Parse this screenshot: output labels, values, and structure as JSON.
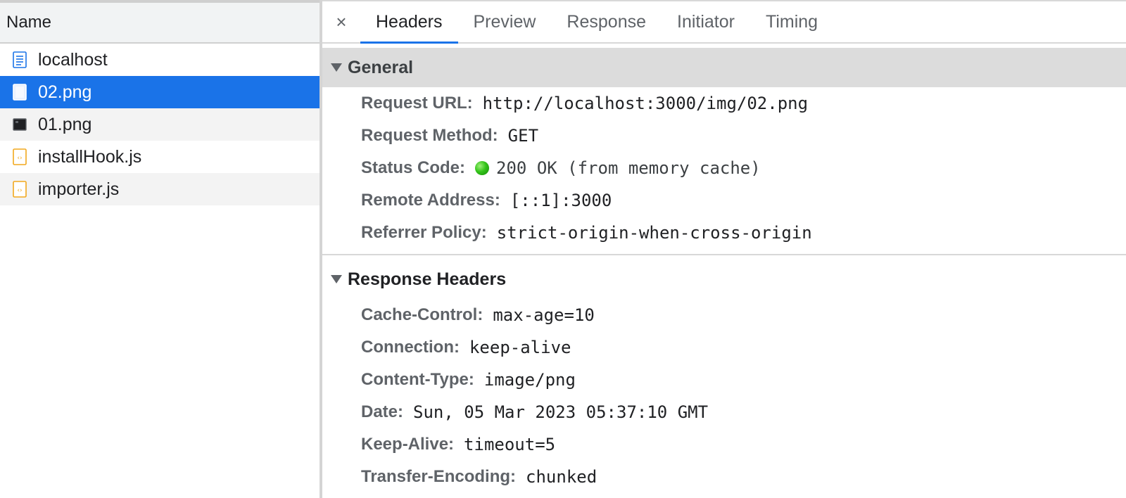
{
  "file_list": {
    "header": "Name",
    "items": [
      {
        "name": "localhost",
        "icon": "document-icon"
      },
      {
        "name": "02.png",
        "icon": "image-icon"
      },
      {
        "name": "01.png",
        "icon": "image-icon"
      },
      {
        "name": "installHook.js",
        "icon": "script-icon"
      },
      {
        "name": "importer.js",
        "icon": "script-icon"
      }
    ],
    "selected": "02.png"
  },
  "tabs": {
    "close": "×",
    "items": [
      "Headers",
      "Preview",
      "Response",
      "Initiator",
      "Timing"
    ],
    "active": "Headers"
  },
  "general": {
    "title": "General",
    "rows": [
      {
        "key": "Request URL:",
        "value": "http://localhost:3000/img/02.png"
      },
      {
        "key": "Request Method:",
        "value": "GET"
      },
      {
        "key": "Status Code:",
        "value": "200 OK (from memory cache)"
      },
      {
        "key": "Remote Address:",
        "value": "[::1]:3000"
      },
      {
        "key": "Referrer Policy:",
        "value": "strict-origin-when-cross-origin"
      }
    ]
  },
  "response_headers": {
    "title": "Response Headers",
    "rows": [
      {
        "key": "Cache-Control:",
        "value": "max-age=10"
      },
      {
        "key": "Connection:",
        "value": "keep-alive"
      },
      {
        "key": "Content-Type:",
        "value": "image/png"
      },
      {
        "key": "Date:",
        "value": "Sun, 05 Mar 2023 05:37:10 GMT"
      },
      {
        "key": "Keep-Alive:",
        "value": "timeout=5"
      },
      {
        "key": "Transfer-Encoding:",
        "value": "chunked"
      }
    ]
  },
  "colors": {
    "selection": "#1a73e8",
    "status_ok": "#34c41a",
    "script_icon": "#f2a81d",
    "document_icon": "#1a73e8"
  }
}
